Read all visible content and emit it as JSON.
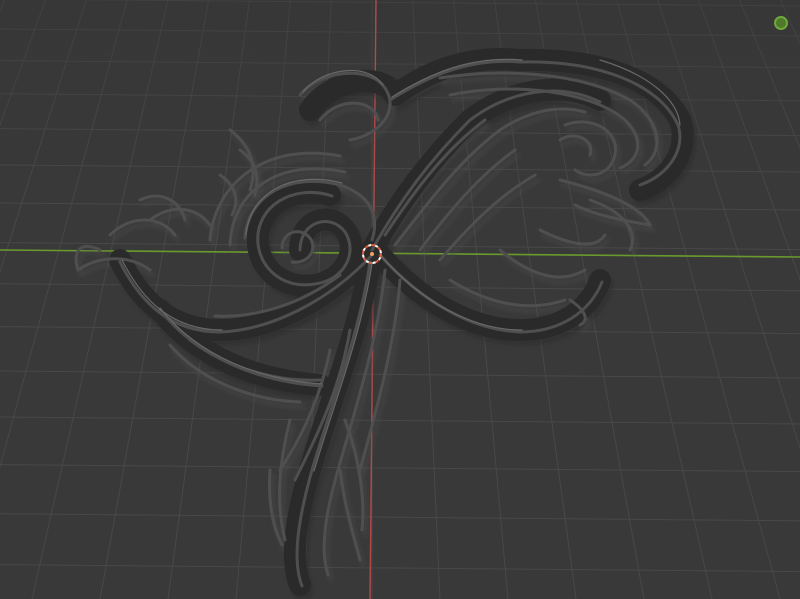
{
  "app": {
    "view": "3d-viewport",
    "grid": true
  },
  "colors": {
    "background": "#393939",
    "grid_line": "#484848",
    "x_axis": "#b34a4a",
    "y_axis": "#6a9a2e",
    "mesh_fill": "#2b2b2b",
    "mesh_edge": "#5a5a5a",
    "mesh_highlight": "#6e6e6e",
    "cursor_red": "#e06040",
    "cursor_white": "#ffffff",
    "gizmo_green": "#6fa83a"
  },
  "icons": {
    "cursor": "3d-cursor-icon",
    "gizmo": "navigation-gizmo-dot-icon",
    "model": "ornamental-scroll-mesh"
  }
}
